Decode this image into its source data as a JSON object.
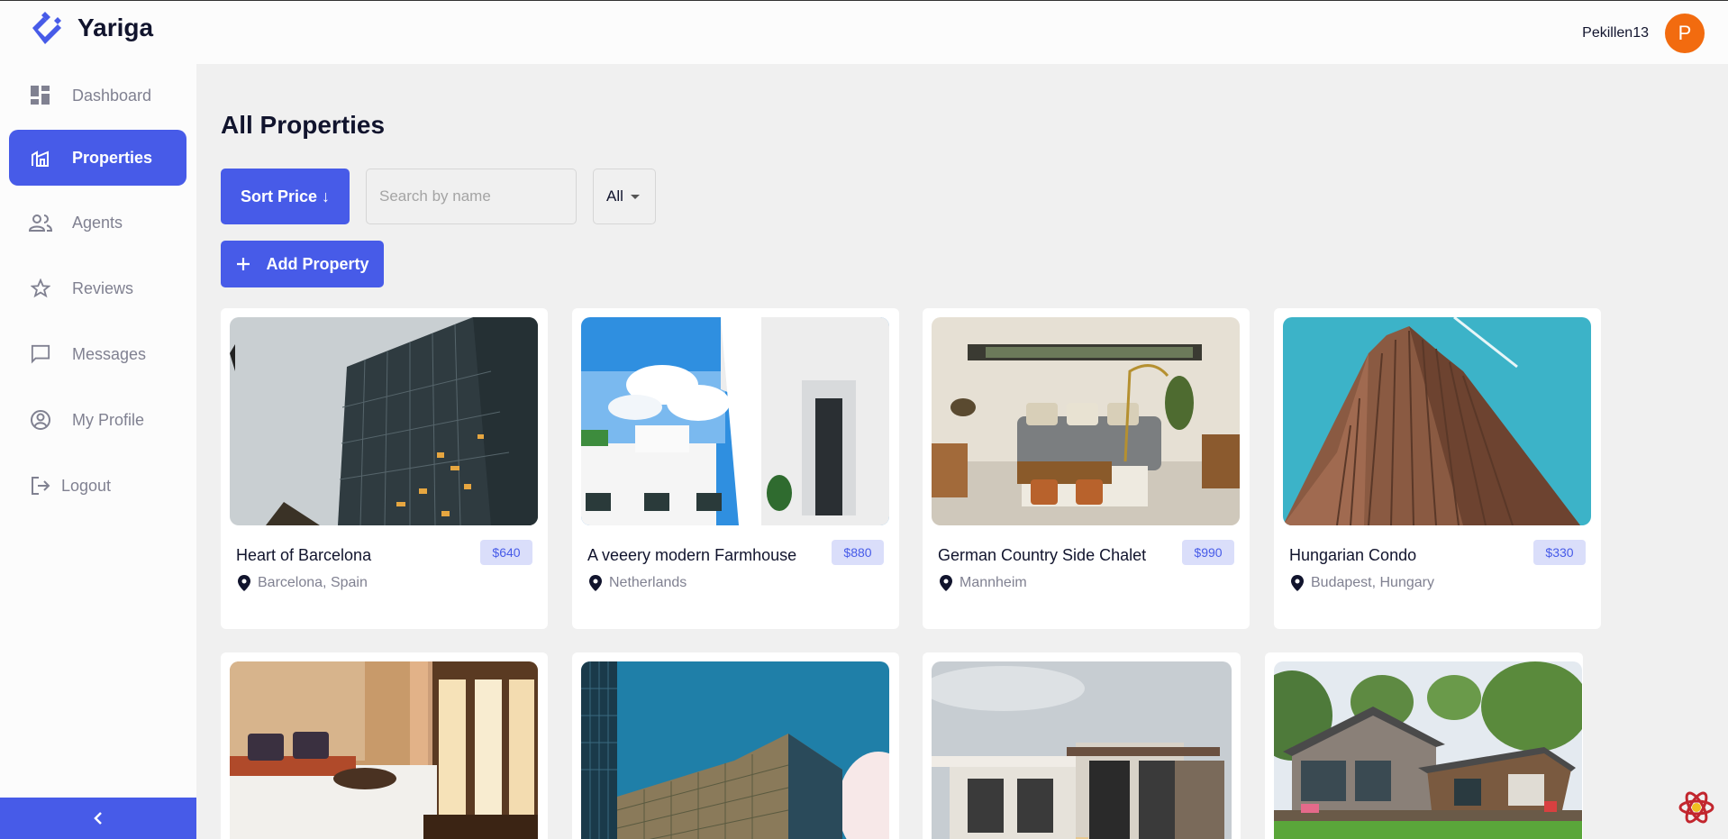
{
  "app": {
    "name": "Yariga",
    "user_name": "Pekillen13",
    "avatar_initial": "P",
    "accent_color": "#475be8",
    "avatar_color": "#f26b0f"
  },
  "sidebar": {
    "items": [
      {
        "label": "Dashboard",
        "icon": "dashboard-icon",
        "active": false
      },
      {
        "label": "Properties",
        "icon": "properties-icon",
        "active": true
      },
      {
        "label": "Agents",
        "icon": "people-icon",
        "active": false
      },
      {
        "label": "Reviews",
        "icon": "star-icon",
        "active": false
      },
      {
        "label": "Messages",
        "icon": "chat-icon",
        "active": false
      },
      {
        "label": "My Profile",
        "icon": "account-circle-icon",
        "active": false
      },
      {
        "label": "Logout",
        "icon": "logout-icon",
        "active": false
      }
    ],
    "collapse_icon": "chevron-left-icon"
  },
  "main": {
    "title": "All Properties",
    "sort_label": "Sort Price ↓",
    "search_placeholder": "Search by name",
    "search_value": "",
    "filter_value": "All",
    "add_label": "Add Property"
  },
  "properties": [
    {
      "title": "Heart of Barcelona",
      "price": "$640",
      "location": "Barcelona, Spain",
      "image": "glass-skyscraper-photo"
    },
    {
      "title": "A veeery modern Farmhouse",
      "price": "$880",
      "location": "Netherlands",
      "image": "white-building-balcony-photo"
    },
    {
      "title": "German Country Side Chalet",
      "price": "$990",
      "location": "Mannheim",
      "image": "living-room-interior-photo"
    },
    {
      "title": "Hungarian Condo",
      "price": "$330",
      "location": "Budapest, Hungary",
      "image": "brown-tower-photo"
    },
    {
      "title": "",
      "price": "",
      "location": "",
      "image": "bedroom-interior-photo"
    },
    {
      "title": "",
      "price": "",
      "location": "",
      "image": "office-tower-sky-photo"
    },
    {
      "title": "",
      "price": "",
      "location": "",
      "image": "modern-villa-photo"
    },
    {
      "title": "",
      "price": "",
      "location": "",
      "image": "wooden-house-garden-photo"
    }
  ]
}
